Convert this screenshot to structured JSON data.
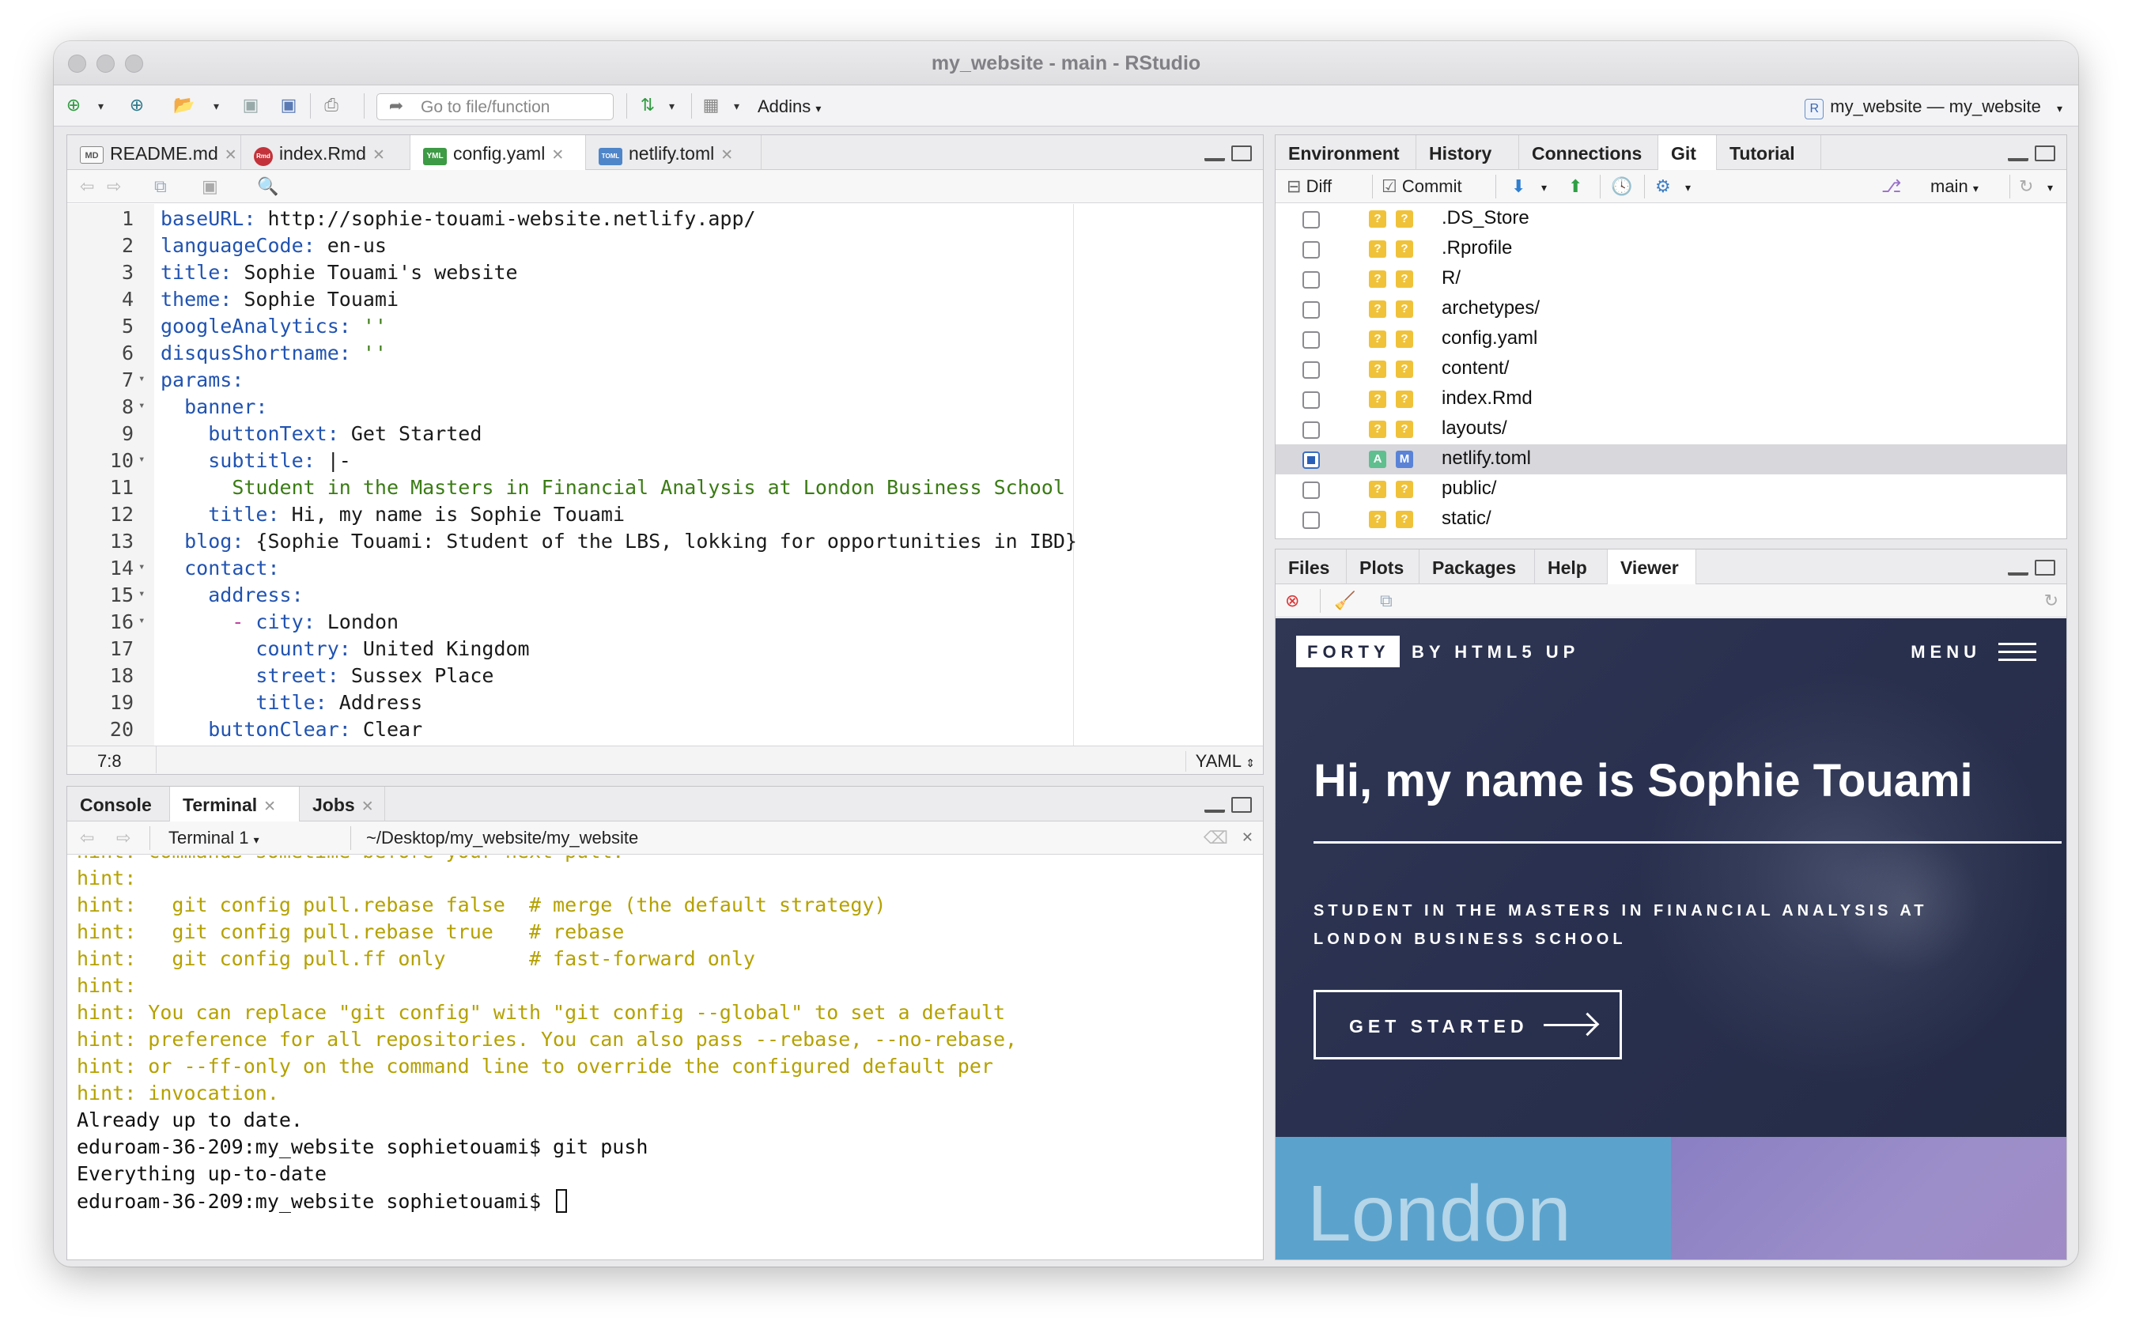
{
  "window": {
    "title": "my_website - main - RStudio"
  },
  "toolbar": {
    "goto_placeholder": "Go to file/function",
    "addins_label": "Addins",
    "project_label": "my_website — my_website"
  },
  "source": {
    "tabs": [
      {
        "label": "README.md",
        "icon": "MD"
      },
      {
        "label": "index.Rmd",
        "icon": "Rmd"
      },
      {
        "label": "config.yaml",
        "icon": "YML"
      },
      {
        "label": "netlify.toml",
        "icon": "TOML"
      }
    ],
    "lines": [
      {
        "n": "1",
        "key": "baseURL:",
        "val": " http://sophie-touami-website.netlify.app/",
        "indent": "",
        "fold": ""
      },
      {
        "n": "2",
        "key": "languageCode:",
        "val": " en-us",
        "indent": "",
        "fold": ""
      },
      {
        "n": "3",
        "key": "title:",
        "val": " Sophie Touami's website",
        "indent": "",
        "fold": ""
      },
      {
        "n": "4",
        "key": "theme:",
        "val": " Sophie Touami",
        "indent": "",
        "fold": ""
      },
      {
        "n": "5",
        "key": "googleAnalytics:",
        "val": " ''",
        "indent": "",
        "fold": "",
        "green": true
      },
      {
        "n": "6",
        "key": "disqusShortname:",
        "val": " ''",
        "indent": "",
        "fold": "",
        "green": true
      },
      {
        "n": "7",
        "key": "params:",
        "val": "",
        "indent": "",
        "fold": "▾"
      },
      {
        "n": "8",
        "key": "banner:",
        "val": "",
        "indent": "  ",
        "fold": "▾"
      },
      {
        "n": "9",
        "key": "buttonText:",
        "val": " Get Started",
        "indent": "    ",
        "fold": ""
      },
      {
        "n": "10",
        "key": "subtitle:",
        "val": " |-",
        "indent": "    ",
        "fold": "▾"
      },
      {
        "n": "11",
        "key": "",
        "val": "Student in the Masters in Financial Analysis at London Business School",
        "indent": "      ",
        "fold": "",
        "green": true
      },
      {
        "n": "12",
        "key": "title:",
        "val": " Hi, my name is Sophie Touami",
        "indent": "    ",
        "fold": ""
      },
      {
        "n": "13",
        "key": "blog:",
        "val": " {Sophie Touami: Student of the LBS, lokking for opportunities in IBD}",
        "indent": "  ",
        "fold": ""
      },
      {
        "n": "14",
        "key": "contact:",
        "val": "",
        "indent": "  ",
        "fold": "▾"
      },
      {
        "n": "15",
        "key": "address:",
        "val": "",
        "indent": "    ",
        "fold": "▾"
      },
      {
        "n": "16",
        "key": "city:",
        "val": " London",
        "indent": "      - ",
        "fold": "▾"
      },
      {
        "n": "17",
        "key": "country:",
        "val": " United Kingdom",
        "indent": "        ",
        "fold": ""
      },
      {
        "n": "18",
        "key": "street:",
        "val": " Sussex Place",
        "indent": "        ",
        "fold": ""
      },
      {
        "n": "19",
        "key": "title:",
        "val": " Address",
        "indent": "        ",
        "fold": ""
      },
      {
        "n": "20",
        "key": "buttonClear:",
        "val": " Clear",
        "indent": "    ",
        "fold": ""
      }
    ],
    "cursor_pos": "7:8",
    "file_type": "YAML"
  },
  "console": {
    "tabs": [
      "Console",
      "Terminal",
      "Jobs"
    ],
    "terminal_name": "Terminal 1",
    "path": "~/Desktop/my_website/my_website",
    "lines": [
      {
        "text": "hint: commands sometime before your next pull:",
        "hint": true
      },
      {
        "text": "hint:",
        "hint": true
      },
      {
        "text": "hint:   git config pull.rebase false  # merge (the default strategy)",
        "hint": true
      },
      {
        "text": "hint:   git config pull.rebase true   # rebase",
        "hint": true
      },
      {
        "text": "hint:   git config pull.ff only       # fast-forward only",
        "hint": true
      },
      {
        "text": "hint:",
        "hint": true
      },
      {
        "text": "hint: You can replace \"git config\" with \"git config --global\" to set a default",
        "hint": true
      },
      {
        "text": "hint: preference for all repositories. You can also pass --rebase, --no-rebase,",
        "hint": true
      },
      {
        "text": "hint: or --ff-only on the command line to override the configured default per",
        "hint": true
      },
      {
        "text": "hint: invocation.",
        "hint": true
      },
      {
        "text": "Already up to date.",
        "hint": false
      },
      {
        "text": "eduroam-36-209:my_website sophietouami$ git push",
        "hint": false
      },
      {
        "text": "Everything up-to-date",
        "hint": false
      },
      {
        "text": "eduroam-36-209:my_website sophietouami$ ",
        "hint": false,
        "cursor": true
      }
    ]
  },
  "env": {
    "tabs": [
      "Environment",
      "History",
      "Connections",
      "Git",
      "Tutorial"
    ],
    "diff_label": "Diff",
    "commit_label": "Commit",
    "branch": "main",
    "files": [
      {
        "name": ".DS_Store",
        "s1": "?",
        "s2": "?",
        "checked": false
      },
      {
        "name": ".Rprofile",
        "s1": "?",
        "s2": "?",
        "checked": false
      },
      {
        "name": "R/",
        "s1": "?",
        "s2": "?",
        "checked": false
      },
      {
        "name": "archetypes/",
        "s1": "?",
        "s2": "?",
        "checked": false
      },
      {
        "name": "config.yaml",
        "s1": "?",
        "s2": "?",
        "checked": false
      },
      {
        "name": "content/",
        "s1": "?",
        "s2": "?",
        "checked": false
      },
      {
        "name": "index.Rmd",
        "s1": "?",
        "s2": "?",
        "checked": false
      },
      {
        "name": "layouts/",
        "s1": "?",
        "s2": "?",
        "checked": false
      },
      {
        "name": "netlify.toml",
        "s1": "A",
        "s2": "M",
        "checked": true
      },
      {
        "name": "public/",
        "s1": "?",
        "s2": "?",
        "checked": false
      },
      {
        "name": "static/",
        "s1": "?",
        "s2": "?",
        "checked": false
      }
    ]
  },
  "files_pane": {
    "tabs": [
      "Files",
      "Plots",
      "Packages",
      "Help",
      "Viewer"
    ]
  },
  "viewer": {
    "brand": "FORTY",
    "byline": "BY HTML5 UP",
    "menu": "MENU",
    "title": "Hi, my name is Sophie Touami",
    "subtitle": "Student in the Masters in Financial Analysis at London Business School",
    "button": "GET STARTED",
    "tile_text": "London"
  }
}
